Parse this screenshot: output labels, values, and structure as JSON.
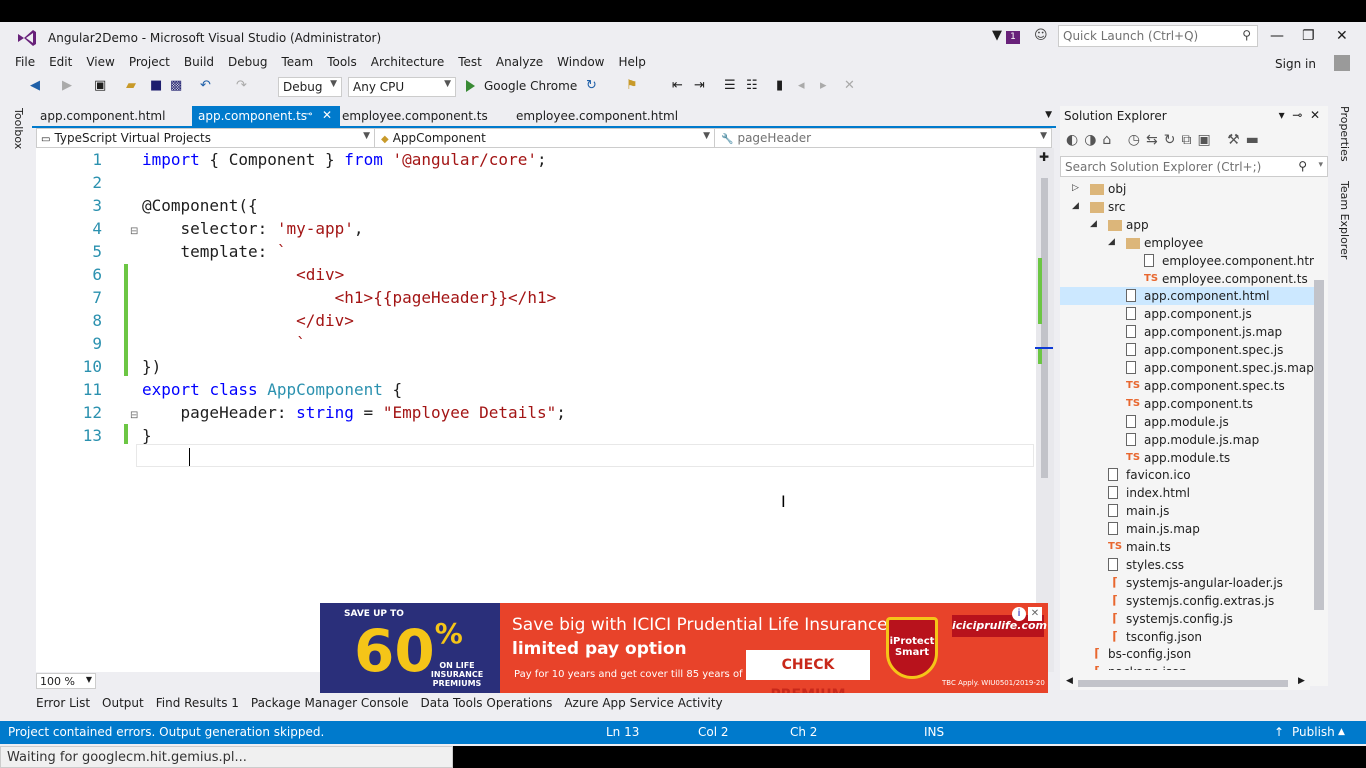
{
  "window": {
    "title": "Angular2Demo - Microsoft Visual Studio (Administrator)",
    "notification_count": "1",
    "quick_launch_placeholder": "Quick Launch (Ctrl+Q)",
    "sign_in": "Sign in"
  },
  "menu": [
    "File",
    "Edit",
    "View",
    "Project",
    "Build",
    "Debug",
    "Team",
    "Tools",
    "Architecture",
    "Test",
    "Analyze",
    "Window",
    "Help"
  ],
  "toolbar": {
    "config": "Debug",
    "platform": "Any CPU",
    "browser": "Google Chrome"
  },
  "toolbox_label": "Toolbox",
  "tabs": [
    {
      "label": "app.component.html"
    },
    {
      "label": "app.component.ts"
    },
    {
      "label": "employee.component.ts"
    },
    {
      "label": "employee.component.html"
    }
  ],
  "navbar": {
    "project": "TypeScript Virtual Projects",
    "class": "AppComponent",
    "member": "pageHeader"
  },
  "editor": {
    "line_numbers": [
      "1",
      "2",
      "3",
      "4",
      "5",
      "6",
      "7",
      "8",
      "9",
      "10",
      "11",
      "12",
      "13"
    ],
    "lines": [
      [
        [
          "kw",
          "import"
        ],
        [
          "pl",
          " { Component } "
        ],
        [
          "kw",
          "from"
        ],
        [
          "pl",
          " "
        ],
        [
          "str",
          "'@angular/core'"
        ],
        [
          "pl",
          ";"
        ]
      ],
      [],
      [
        [
          "pl",
          "@Component({"
        ]
      ],
      [
        [
          "pl",
          "    selector: "
        ],
        [
          "str",
          "'my-app'"
        ],
        [
          "pl",
          ","
        ]
      ],
      [
        [
          "pl",
          "    template: "
        ],
        [
          "str",
          "`"
        ]
      ],
      [
        [
          "str",
          "                <div>"
        ]
      ],
      [
        [
          "str",
          "                    <h1>{{pageHeader}}</h1>"
        ]
      ],
      [
        [
          "str",
          "                </div>"
        ]
      ],
      [
        [
          "str",
          "                `"
        ]
      ],
      [
        [
          "pl",
          "})"
        ]
      ],
      [
        [
          "kw",
          "export"
        ],
        [
          "pl",
          " "
        ],
        [
          "kw",
          "class"
        ],
        [
          "pl",
          " "
        ],
        [
          "typ",
          "AppComponent"
        ],
        [
          "pl",
          " {"
        ]
      ],
      [
        [
          "pl",
          "    pageHeader: "
        ],
        [
          "kw",
          "string"
        ],
        [
          "pl",
          " = "
        ],
        [
          "str",
          "\"Employee Details\""
        ],
        [
          "pl",
          ";"
        ]
      ],
      [
        [
          "pl",
          "}"
        ]
      ]
    ],
    "zoom": "100 %"
  },
  "bottom_tabs": [
    "Error List",
    "Output",
    "Find Results 1",
    "Package Manager Console",
    "Data Tools Operations",
    "Azure App Service Activity"
  ],
  "status": {
    "message": "Project contained errors. Output generation skipped.",
    "ln": "Ln 13",
    "col": "Col 2",
    "ch": "Ch 2",
    "mode": "INS",
    "publish": "Publish"
  },
  "solution_explorer": {
    "title": "Solution Explorer",
    "search_placeholder": "Search Solution Explorer (Ctrl+;)",
    "items": [
      {
        "label": "obj",
        "type": "folder",
        "level": 0,
        "arrow": "▷"
      },
      {
        "label": "src",
        "type": "folder",
        "level": 0,
        "arrow": "◢"
      },
      {
        "label": "app",
        "type": "folder",
        "level": 1,
        "arrow": "◢"
      },
      {
        "label": "employee",
        "type": "folder",
        "level": 2,
        "arrow": "◢"
      },
      {
        "label": "employee.component.html",
        "type": "file",
        "level": 3,
        "arrow": ""
      },
      {
        "label": "employee.component.ts",
        "type": "ts",
        "level": 3,
        "arrow": ""
      },
      {
        "label": "app.component.html",
        "type": "file",
        "level": 2,
        "arrow": "",
        "selected": true
      },
      {
        "label": "app.component.js",
        "type": "file",
        "level": 2,
        "arrow": ""
      },
      {
        "label": "app.component.js.map",
        "type": "file",
        "level": 2,
        "arrow": ""
      },
      {
        "label": "app.component.spec.js",
        "type": "file",
        "level": 2,
        "arrow": ""
      },
      {
        "label": "app.component.spec.js.map",
        "type": "file",
        "level": 2,
        "arrow": ""
      },
      {
        "label": "app.component.spec.ts",
        "type": "ts",
        "level": 2,
        "arrow": ""
      },
      {
        "label": "app.component.ts",
        "type": "ts",
        "level": 2,
        "arrow": ""
      },
      {
        "label": "app.module.js",
        "type": "file",
        "level": 2,
        "arrow": ""
      },
      {
        "label": "app.module.js.map",
        "type": "file",
        "level": 2,
        "arrow": ""
      },
      {
        "label": "app.module.ts",
        "type": "ts",
        "level": 2,
        "arrow": ""
      },
      {
        "label": "favicon.ico",
        "type": "file",
        "level": 1,
        "arrow": ""
      },
      {
        "label": "index.html",
        "type": "file",
        "level": 1,
        "arrow": ""
      },
      {
        "label": "main.js",
        "type": "file",
        "level": 1,
        "arrow": ""
      },
      {
        "label": "main.js.map",
        "type": "file",
        "level": 1,
        "arrow": ""
      },
      {
        "label": "main.ts",
        "type": "ts",
        "level": 1,
        "arrow": ""
      },
      {
        "label": "styles.css",
        "type": "file",
        "level": 1,
        "arrow": ""
      },
      {
        "label": "systemjs-angular-loader.js",
        "type": "json",
        "level": 1,
        "arrow": ""
      },
      {
        "label": "systemjs.config.extras.js",
        "type": "json",
        "level": 1,
        "arrow": ""
      },
      {
        "label": "systemjs.config.js",
        "type": "json",
        "level": 1,
        "arrow": ""
      },
      {
        "label": "tsconfig.json",
        "type": "json",
        "level": 1,
        "arrow": ""
      },
      {
        "label": "bs-config.json",
        "type": "json",
        "level": 0,
        "arrow": ""
      },
      {
        "label": "package.json",
        "type": "json",
        "level": 0,
        "arrow": ""
      }
    ]
  },
  "right_tabs": [
    "Properties",
    "Team Explorer"
  ],
  "ad": {
    "save_up_to": "SAVE UP TO",
    "percent": "60",
    "percent_sign": "%",
    "on_life": "ON LIFE INSURANCE PREMIUMS",
    "headline_1": "Save big with ICICI Prudential Life Insurance's",
    "headline_2": "limited pay option",
    "sub": "Pay for 10 years and get cover till 85 years of age",
    "cta": "CHECK PREMIUM",
    "product": "iProtect Smart",
    "brand": "iciciprulife.com",
    "disclaimer": "TBC Apply. WIU0501/2019-20"
  },
  "browser_status": "Waiting for googlecm.hit.gemius.pl..."
}
